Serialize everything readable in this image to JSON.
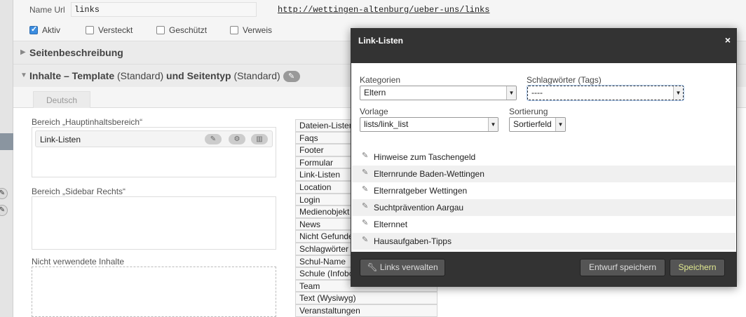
{
  "page": {
    "name_url": {
      "label": "Name Url",
      "value": "links",
      "link": "http://wettingen-altenburg/ueber-uns/links"
    },
    "flags": [
      {
        "label": "Aktiv",
        "checked": true
      },
      {
        "label": "Versteckt",
        "checked": false
      },
      {
        "label": "Geschützt",
        "checked": false
      },
      {
        "label": "Verweis",
        "checked": false
      }
    ],
    "section1": {
      "title": "Seitenbeschreibung"
    },
    "section2": {
      "title_a": "Inhalte – Template",
      "title_b": " (Standard) ",
      "title_c": "und Seitentyp",
      "title_d": " (Standard)"
    },
    "tab": "Deutsch",
    "areas": {
      "main_label": "Bereich „Hauptinhaltsbereich“",
      "main_item": "Link-Listen",
      "sidebar_label": "Bereich „Sidebar Rechts“",
      "unused_label": "Nicht verwendete Inhalte"
    },
    "content_types": [
      "Dateien-Listen",
      "Faqs",
      "Footer",
      "Formular",
      "Link-Listen",
      "Location",
      "Login",
      "Medienobjekt",
      "News",
      "Nicht Gefunden",
      "Schlagwörter",
      "Schul-Name",
      "Schule (Infobox)",
      "Team",
      "Text (Wysiwyg)",
      "Veranstaltungen"
    ]
  },
  "modal": {
    "title": "Link-Listen",
    "close": "×",
    "kategorien": {
      "label": "Kategorien",
      "value": "Eltern"
    },
    "tags": {
      "label": "Schlagwörter (Tags)",
      "value": "----"
    },
    "vorlage": {
      "label": "Vorlage",
      "value": "lists/link_list"
    },
    "sortierung": {
      "label": "Sortierung",
      "value": "Sortierfeld"
    },
    "links": [
      "Hinweise zum Taschengeld",
      "Elternrunde Baden-Wettingen",
      "Elternratgeber Wettingen",
      "Suchtprävention Aargau",
      "Elternnet",
      "Hausaufgaben-Tipps"
    ],
    "buttons": {
      "manage": "Links verwalten",
      "draft": "Entwurf speichern",
      "save": "Speichern"
    }
  }
}
